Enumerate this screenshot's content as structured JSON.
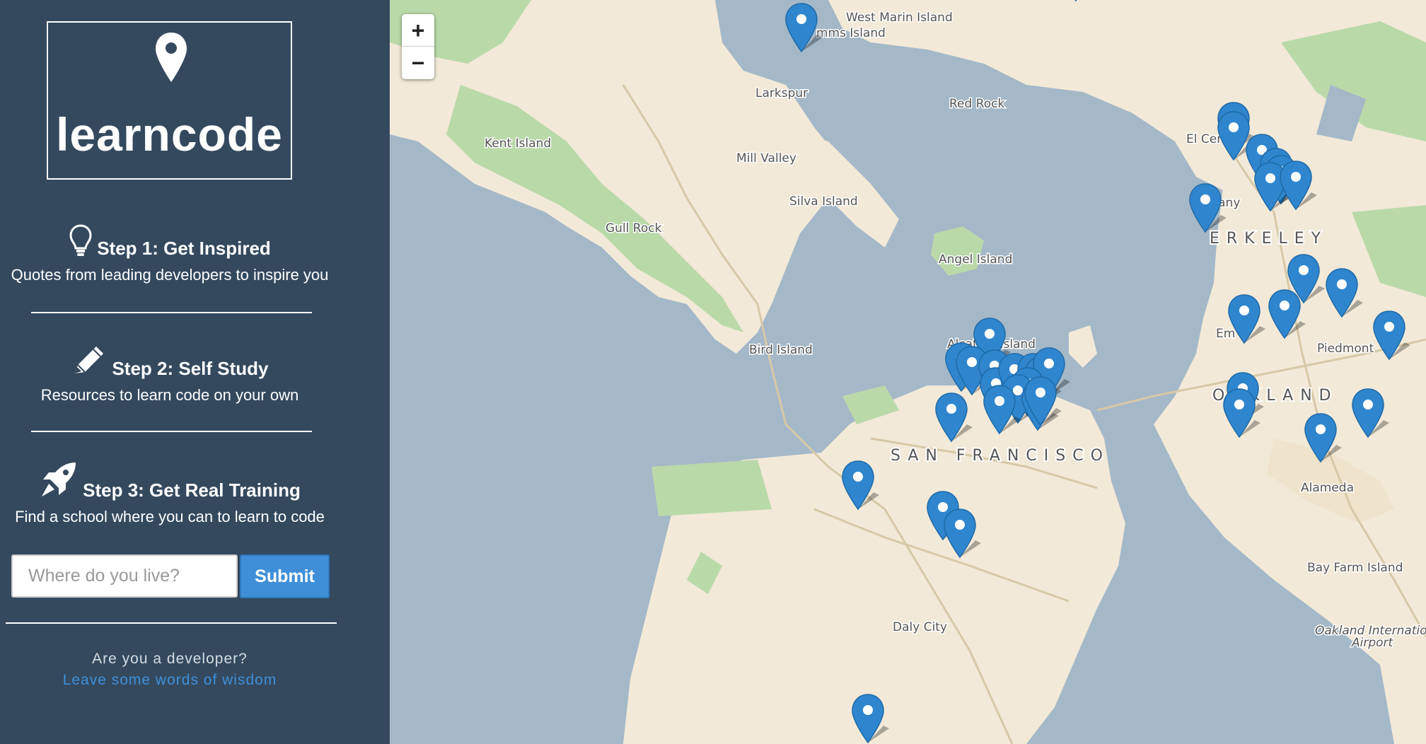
{
  "app": {
    "logo_text": "learncode"
  },
  "steps": [
    {
      "title": "Step 1: Get Inspired",
      "desc": "Quotes from leading developers to inspire you",
      "icon": "lightbulb-icon"
    },
    {
      "title": "Step 2: Self Study",
      "desc": "Resources to learn code on your own",
      "icon": "pencil-icon"
    },
    {
      "title": "Step 3: Get Real Training",
      "desc": "Find a school where you can to learn to code",
      "icon": "rocket-icon"
    }
  ],
  "search": {
    "placeholder": "Where do you live?",
    "value": "",
    "submit_label": "Submit"
  },
  "developer": {
    "question": "Are you a developer?",
    "link_text": "Leave some words of wisdom"
  },
  "map": {
    "zoom_in": "+",
    "zoom_out": "−",
    "labels": {
      "west_marin": "West Marin Island",
      "simms": "mms Island",
      "larkspur": "Larkspur",
      "red_rock": "Red Rock",
      "kent": "Kent Island",
      "el_cerrito": "El Cer",
      "mill_valley": "Mill Valley",
      "silva": "Silva Island",
      "albany": "Albany",
      "gull_rock": "Gull Rock",
      "berkeley": "ERKELEY",
      "angel": "Angel Island",
      "bird": "Bird Island",
      "alcatraz": "Alcatraz Island",
      "emeryville": "Em",
      "piedmont": "Piedmont",
      "oakland": "OAKLAND",
      "sf": "SAN FRANCISCO",
      "alameda": "Alameda",
      "bay_farm": "Bay Farm Island",
      "daly_city": "Daly City",
      "oak_airport_1": "Oakland Internation",
      "oak_airport_2": "Airport"
    }
  },
  "colors": {
    "sidebar": "#34495e",
    "accent": "#3f8fd8",
    "marker": "#2f86ce",
    "water": "#a4b8c8",
    "land": "#f2e9d8",
    "park": "#b9d9a9"
  }
}
